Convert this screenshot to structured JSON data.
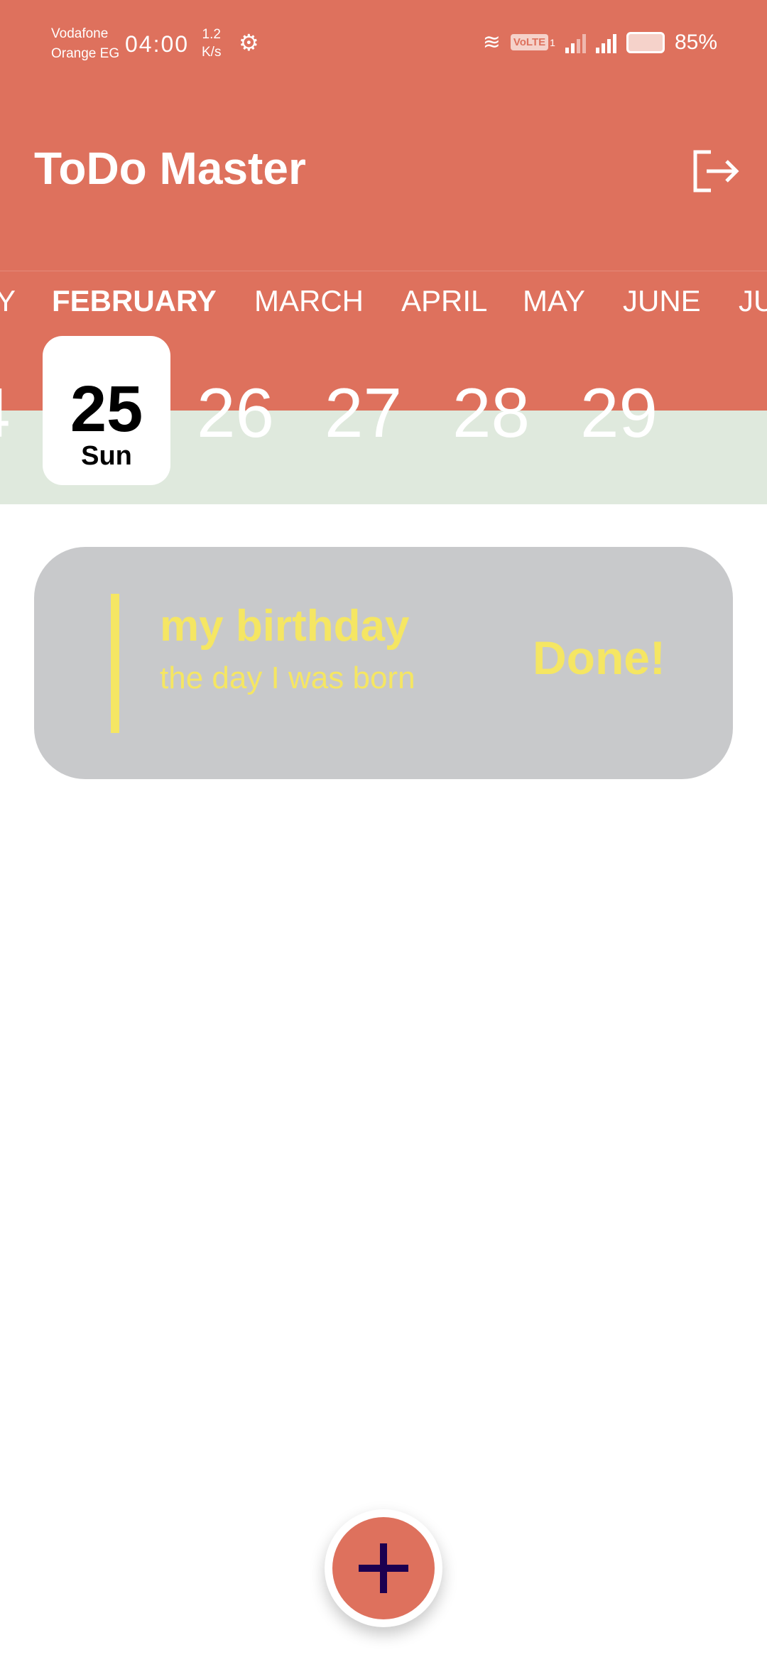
{
  "status_bar": {
    "carrier_1": "Vodafone",
    "carrier_2": "Orange EG",
    "time": "04:00",
    "speed_value": "1.2",
    "speed_unit": "K/s",
    "volte": "VoLTE",
    "sim": "1",
    "battery": "85%"
  },
  "app": {
    "title": "ToDo Master",
    "logout_icon": "logout-icon"
  },
  "months": [
    "Y",
    "FEBRUARY",
    "MARCH",
    "APRIL",
    "MAY",
    "JUNE",
    "JU"
  ],
  "selected_month": "FEBRUARY",
  "days": {
    "partial": "4",
    "selected_number": "25",
    "selected_weekday": "Sun",
    "others": [
      "26",
      "27",
      "28",
      "29"
    ]
  },
  "tasks": [
    {
      "title": "my birthday",
      "description": "the day I was born",
      "status": "Done!"
    }
  ],
  "fab": {
    "icon": "plus-icon"
  },
  "colors": {
    "primary": "#DE715D",
    "date_strip": "#DFE9DD",
    "card": "#C8C9CB",
    "accent_yellow": "#F5E663",
    "plus": "#1C0050"
  }
}
